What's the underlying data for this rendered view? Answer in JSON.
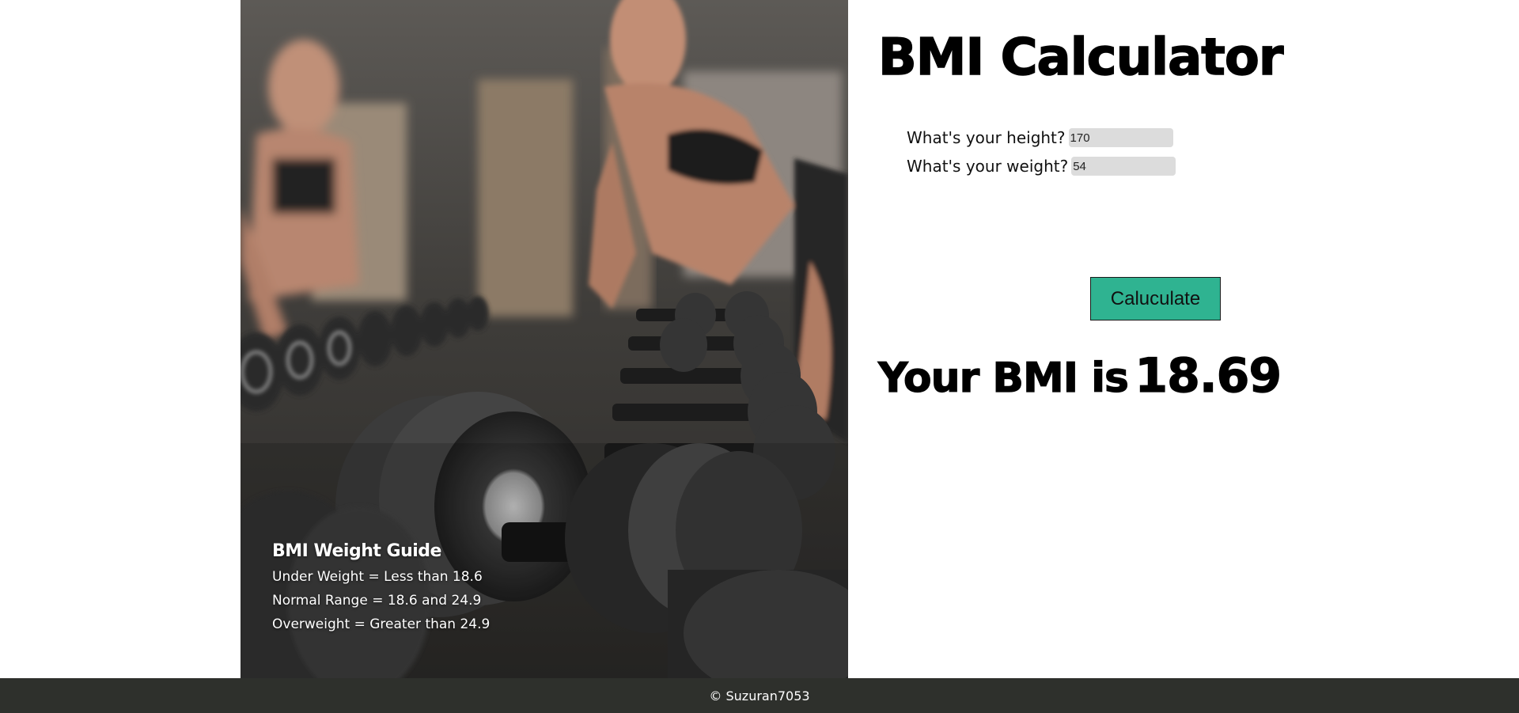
{
  "guide": {
    "title": "BMI Weight Guide",
    "underweight": "Under Weight = Less than 18.6",
    "normal": "Normal Range = 18.6 and 24.9",
    "overweight": "Overweight = Greater than 24.9"
  },
  "calculator": {
    "title": "BMI Calculator",
    "height_label": "What's your height?",
    "height_value": "170",
    "weight_label": "What's your weight?",
    "weight_value": "54",
    "button_label": "Caluculate",
    "button_color": "#2fb391",
    "result_prefix": "Your BMI is",
    "result_value": "18.69"
  },
  "footer": {
    "text": "© Suzuran7053",
    "background": "#2e302c"
  },
  "images": {
    "hero": "gym-dumbbells-photo"
  }
}
